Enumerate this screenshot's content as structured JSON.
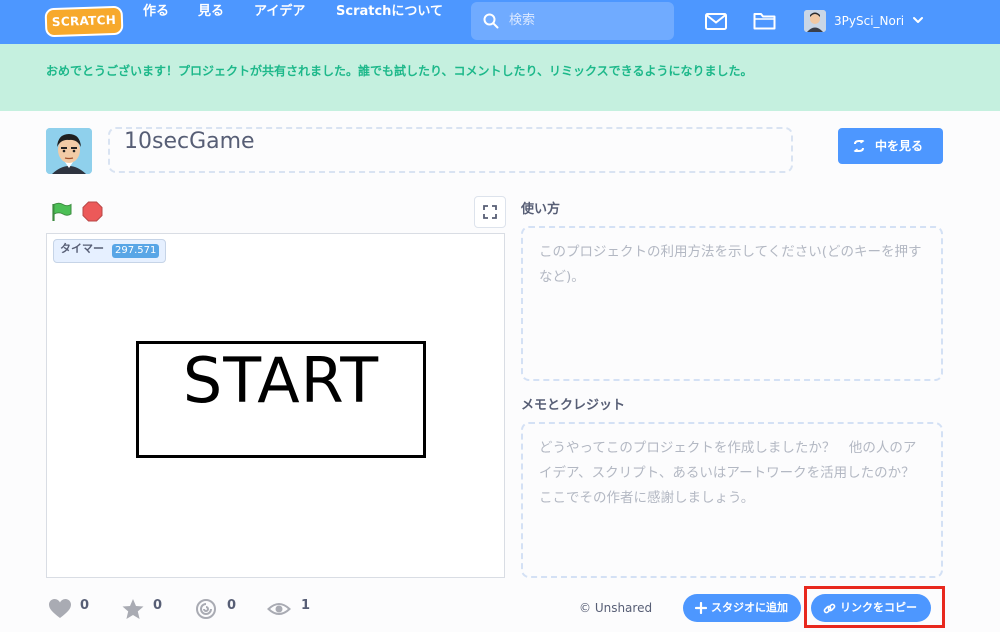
{
  "nav": {
    "logo": "SCRATCH",
    "links": [
      "作る",
      "見る",
      "アイデア",
      "Scratchについて"
    ],
    "search_placeholder": "検索",
    "username": "3PySci_Nori",
    "icons": [
      "mail-icon",
      "folder-icon",
      "chevron-down-icon"
    ]
  },
  "banner": {
    "message": "おめでとうございます！プロジェクトが共有されました。誰でも試したり、コメントしたり、リミックスできるようになりました。"
  },
  "project": {
    "title": "10secGame",
    "see_inside_label": "中を見る"
  },
  "stage": {
    "monitor_label": "タイマー",
    "monitor_value": "297.571",
    "start_text": "START"
  },
  "instructions": {
    "label": "使い方",
    "placeholder": "このプロジェクトの利用方法を示してください(どのキーを押すなど)。"
  },
  "notes": {
    "label": "メモとクレジット",
    "placeholder": "どうやってこのプロジェクトを作成しましたか？　他の人のアイデア、スクリプト、あるいはアートワークを活用したのか？　ここでその作者に感謝しましょう。"
  },
  "stats": {
    "loves": "0",
    "favorites": "0",
    "remixes": "0",
    "views": "1"
  },
  "footer": {
    "unshared": "© Unshared",
    "add_to_studio": "スタジオに追加",
    "copy_link": "リンクをコピー"
  },
  "colors": {
    "nav_blue": "#4d97ff",
    "banner_bg": "#c5f0df",
    "banner_text": "#1db88a",
    "highlight_red": "#e8281e"
  }
}
